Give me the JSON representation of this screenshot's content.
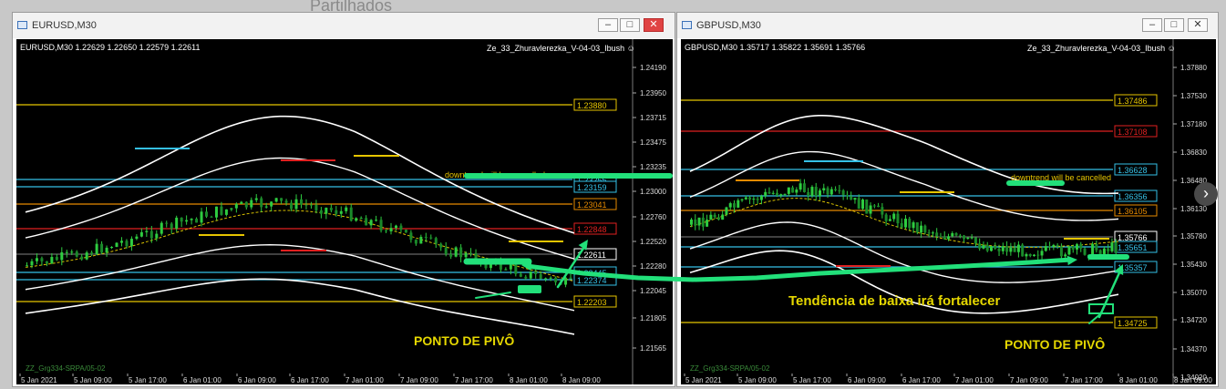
{
  "background": {
    "text": "Partilhados"
  },
  "windows": [
    {
      "title": "EURUSD,M30",
      "controls": [
        "minimize",
        "maximize",
        "close"
      ],
      "chart": {
        "symbol_line": "EURUSD,M30  1.22629 1.22650 1.22579 1.22611",
        "indicator": "Ze_33_Zhuravlerezka_V-04-03_Ibush",
        "zigzag_label": "ZZ_Grg334-SRPA/05-02",
        "price_ticks": [
          "1.24190",
          "1.23950",
          "1.23715",
          "1.23475",
          "1.23235",
          "1.23000",
          "1.22760",
          "1.22520",
          "1.22280",
          "1.22045",
          "1.21805",
          "1.21565"
        ],
        "time_ticks": [
          "5 Jan 2021",
          "5 Jan 09:00",
          "5 Jan 17:00",
          "6 Jan 01:00",
          "6 Jan 09:00",
          "6 Jan 17:00",
          "7 Jan 01:00",
          "7 Jan 09:00",
          "7 Jan 17:00",
          "8 Jan 01:00",
          "8 Jan 09:00"
        ],
        "levels": [
          {
            "label": "1.23880",
            "color": "#e6c500"
          },
          {
            "label": "1.23255",
            "color": "#35c0e6"
          },
          {
            "label": "1.23159",
            "color": "#35c0e6"
          },
          {
            "label": "1.23041",
            "color": "#e68a00"
          },
          {
            "label": "1.22848",
            "color": "#e02020"
          },
          {
            "label": "1.22611",
            "color": "#ffffff"
          },
          {
            "label": "1.22445",
            "color": "#35c0e6"
          },
          {
            "label": "1.22374",
            "color": "#35c0e6"
          },
          {
            "label": "1.22203",
            "color": "#e6c500"
          }
        ],
        "annotation": "downtrend will be cancelled",
        "pivot": "PONTO DE PIVÔ"
      }
    },
    {
      "title": "GBPUSD,M30",
      "controls": [
        "minimize",
        "maximize",
        "close"
      ],
      "chart": {
        "symbol_line": "GBPUSD,M30  1.35717 1.35822 1.35691 1.35766",
        "indicator": "Ze_33_Zhuravlerezka_V-04-03_Ibush",
        "zigzag_label": "ZZ_Grg334-SRPA/05-02",
        "price_ticks": [
          "1.37880",
          "1.37530",
          "1.37180",
          "1.36830",
          "1.36480",
          "1.36130",
          "1.35780",
          "1.35430",
          "1.35070",
          "1.34720",
          "1.34370",
          "1.34020"
        ],
        "time_ticks": [
          "5 Jan 2021",
          "5 Jan 09:00",
          "5 Jan 17:00",
          "6 Jan 09:00",
          "6 Jan 17:00",
          "7 Jan 01:00",
          "7 Jan 09:00",
          "7 Jan 17:00",
          "8 Jan 01:00",
          "8 Jan 09:00"
        ],
        "levels": [
          {
            "label": "1.37486",
            "color": "#e6c500"
          },
          {
            "label": "1.37108",
            "color": "#e02020"
          },
          {
            "label": "1.36628",
            "color": "#35c0e6"
          },
          {
            "label": "1.36356",
            "color": "#35c0e6"
          },
          {
            "label": "1.36105",
            "color": "#e68a00"
          },
          {
            "label": "1.35766",
            "color": "#ffffff"
          },
          {
            "label": "1.35651",
            "color": "#35c0e6"
          },
          {
            "label": "1.35357",
            "color": "#35c0e6"
          },
          {
            "label": "1.34725",
            "color": "#e6c500"
          }
        ],
        "annotation": "downtrend will be cancelled",
        "pivot": "PONTO DE PIVÔ"
      }
    }
  ],
  "overlay": {
    "trend_text": "Tendência de baixa irá fortalecer"
  },
  "nav_icon": "chevron-right-icon"
}
